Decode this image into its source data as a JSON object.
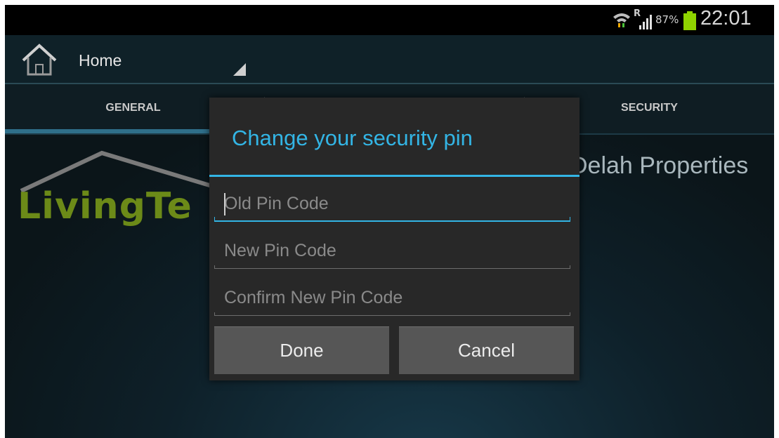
{
  "status_bar": {
    "roaming_indicator": "R",
    "battery_percent": "87%",
    "battery_level": 0.87,
    "time": "22:01",
    "icons": [
      "wifi-data-icon",
      "signal-icon",
      "battery-icon"
    ],
    "battery_color": "#8fd400"
  },
  "action_bar": {
    "title": "Home",
    "icon": "home-icon"
  },
  "tabs": [
    {
      "label": "GENERAL",
      "selected": true
    },
    {
      "label": "",
      "selected": false
    },
    {
      "label": "SECURITY",
      "selected": false
    }
  ],
  "content": {
    "logo_text": "LivingTe",
    "company_name": "Delah Properties"
  },
  "dialog": {
    "title": "Change your security pin",
    "fields": [
      {
        "placeholder": "Old Pin Code",
        "value": "",
        "focused": true
      },
      {
        "placeholder": "New Pin Code",
        "value": "",
        "focused": false
      },
      {
        "placeholder": "Confirm New Pin Code",
        "value": "",
        "focused": false
      }
    ],
    "done_label": "Done",
    "cancel_label": "Cancel"
  },
  "colors": {
    "accent": "#33b5e5",
    "logo_green": "#6c8a18",
    "dialog_bg": "#282828",
    "button_bg": "#565656"
  }
}
